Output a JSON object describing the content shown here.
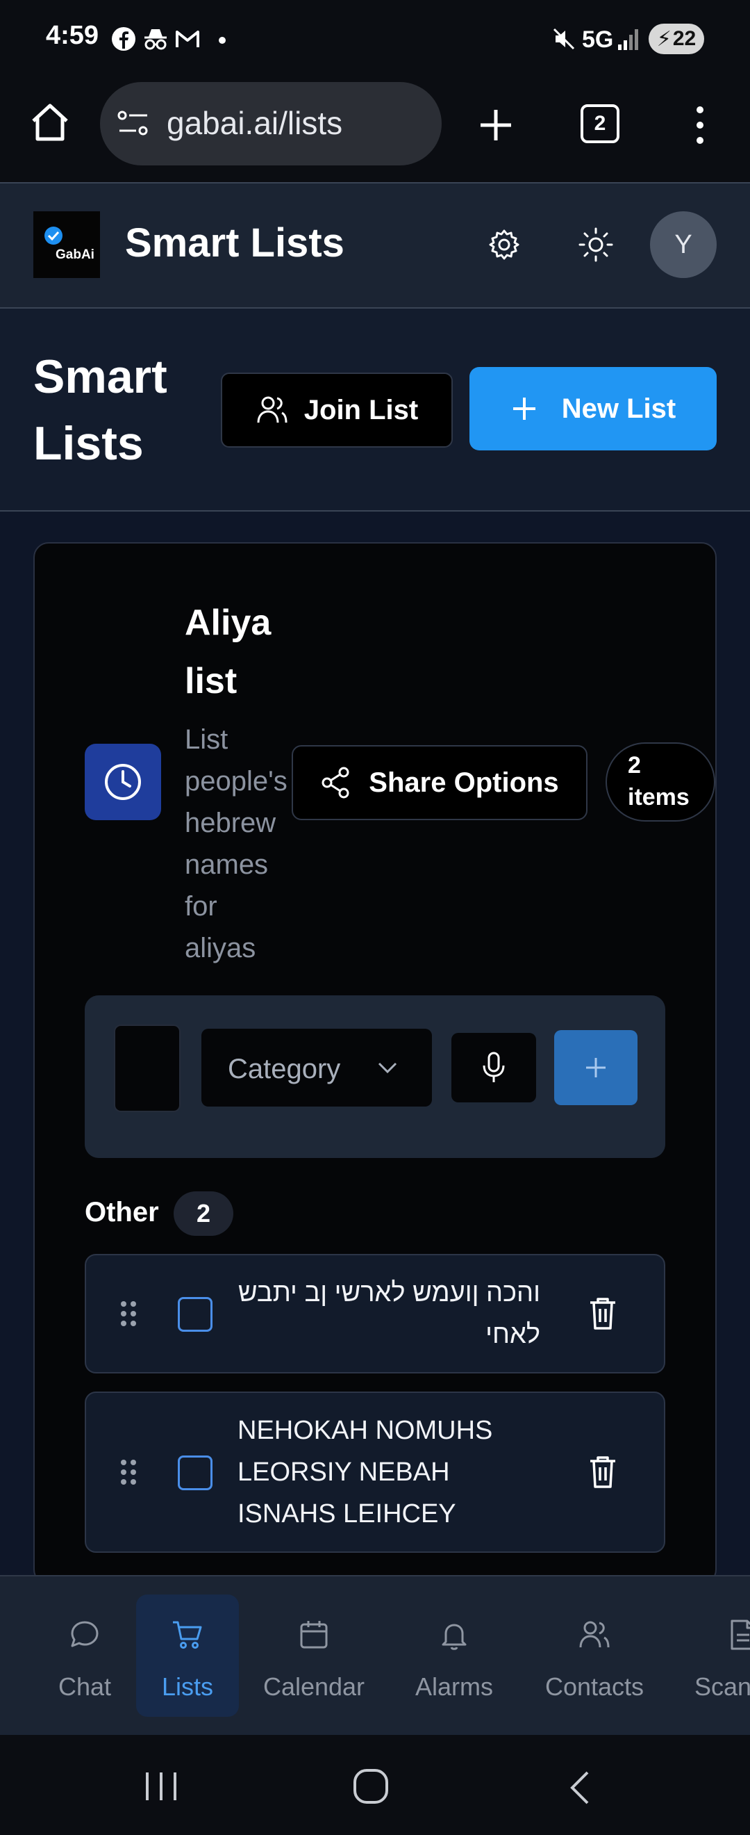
{
  "status_bar": {
    "time": "4:59",
    "network": "5G",
    "battery": "22"
  },
  "browser": {
    "url": "gabai.ai/lists",
    "tab_count": "2"
  },
  "header": {
    "app_title": "Smart Lists",
    "logo_text": "GabAi",
    "avatar_initial": "Y"
  },
  "page": {
    "title": "Smart Lists",
    "join_label": "Join List",
    "new_label": "New List"
  },
  "list": {
    "title": "Aliya list",
    "description": "List people's hebrew names for aliyas",
    "share_label": "Share Options",
    "items_badge": "2 items",
    "category_placeholder": "Category",
    "group": {
      "label": "Other",
      "count": "2"
    },
    "items": [
      {
        "text": "והכה ןועמש לארשי ןב יתבש לאחי",
        "checked": false
      },
      {
        "text": "NEHOKAH NOMUHS LEORSIY NEBAH ISNAHS LEIHCEY",
        "checked": false
      }
    ]
  },
  "nav": {
    "active": "Lists",
    "items": [
      "Chat",
      "Lists",
      "Calendar",
      "Alarms",
      "Contacts",
      "Scan"
    ]
  },
  "colors": {
    "accent": "#2196f3",
    "background": "#0e1628",
    "card": "#050608"
  }
}
